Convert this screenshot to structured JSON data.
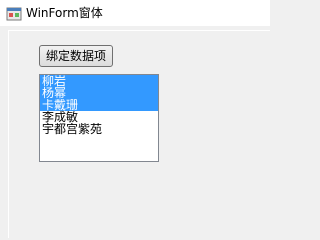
{
  "window": {
    "title": "WinForm窗体",
    "icon": "winform-app-icon"
  },
  "form": {
    "bind_button_label": "绑定数据项",
    "listbox": {
      "items": [
        {
          "label": "柳岩",
          "selected": true
        },
        {
          "label": "杨幂",
          "selected": true
        },
        {
          "label": "卡戴珊",
          "selected": true
        },
        {
          "label": "李成敏",
          "selected": false
        },
        {
          "label": "宇都宫紫苑",
          "selected": false
        }
      ],
      "selection_color": "#3399ff"
    }
  }
}
